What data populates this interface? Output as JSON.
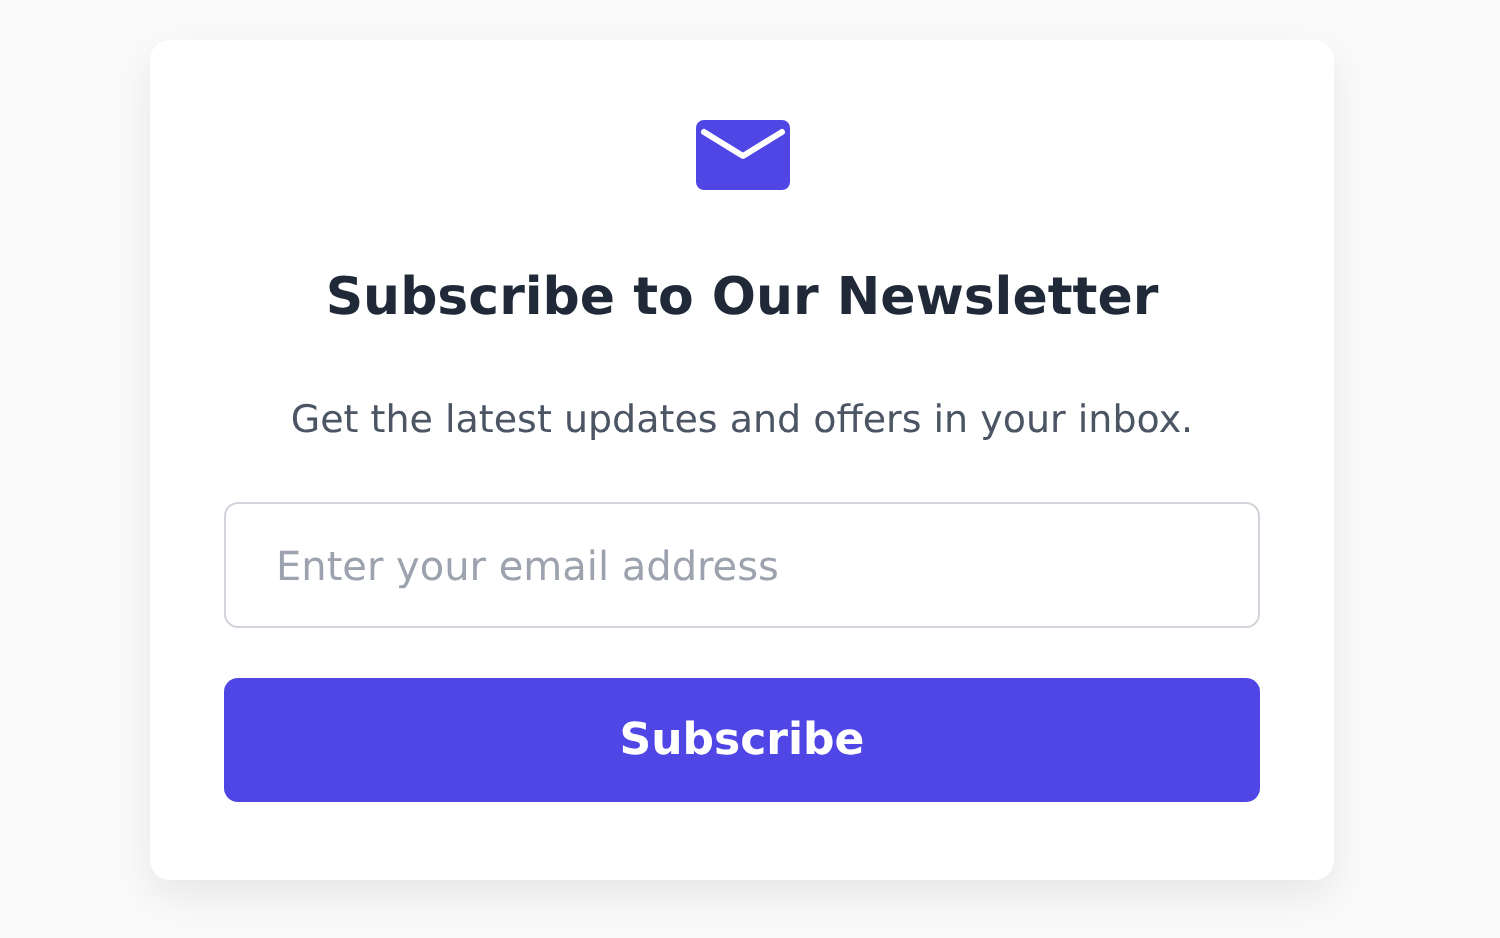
{
  "card": {
    "title": "Subscribe to Our Newsletter",
    "subtitle": "Get the latest updates and offers in your inbox.",
    "email_field": {
      "placeholder": "Enter your email address"
    },
    "button": "Subscribe"
  }
}
